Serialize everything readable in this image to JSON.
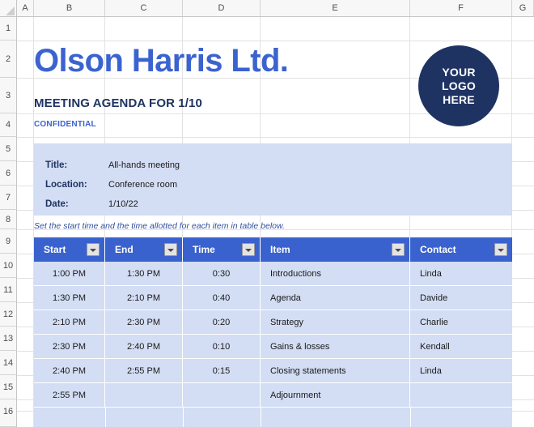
{
  "spreadsheet": {
    "column_headers": [
      "A",
      "B",
      "C",
      "D",
      "E",
      "F",
      "G"
    ],
    "row_headers": [
      "1",
      "2",
      "3",
      "4",
      "5",
      "6",
      "7",
      "8",
      "9",
      "10",
      "11",
      "12",
      "13",
      "14",
      "15",
      "16"
    ],
    "corner_icon": "select-all-triangle-icon"
  },
  "document": {
    "company_title": "Olson Harris Ltd.",
    "agenda_subtitle": "MEETING AGENDA FOR 1/10",
    "confidential_label": "CONFIDENTIAL",
    "instruction_note": "Set the start time and the time allotted for each item in table below."
  },
  "logo": {
    "line1": "YOUR",
    "line2": "LOGO",
    "line3": "HERE"
  },
  "info": {
    "rows": [
      {
        "label": "Title:",
        "value": "All-hands meeting"
      },
      {
        "label": "Location:",
        "value": "Conference room"
      },
      {
        "label": "Date:",
        "value": "1/10/22"
      }
    ]
  },
  "agenda_table": {
    "columns": [
      "Start",
      "End",
      "Time",
      "Item",
      "Contact"
    ],
    "filter_icon": "filter-dropdown-icon",
    "rows": [
      {
        "start": "1:00 PM",
        "end": "1:30 PM",
        "time": "0:30",
        "item": "Introductions",
        "contact": "Linda"
      },
      {
        "start": "1:30 PM",
        "end": "2:10 PM",
        "time": "0:40",
        "item": "Agenda",
        "contact": "Davide"
      },
      {
        "start": "2:10 PM",
        "end": "2:30 PM",
        "time": "0:20",
        "item": "Strategy",
        "contact": "Charlie"
      },
      {
        "start": "2:30 PM",
        "end": "2:40 PM",
        "time": "0:10",
        "item": "Gains & losses",
        "contact": "Kendall"
      },
      {
        "start": "2:40 PM",
        "end": "2:55 PM",
        "time": "0:15",
        "item": "Closing statements",
        "contact": "Linda"
      },
      {
        "start": "2:55 PM",
        "end": "",
        "time": "",
        "item": "Adjournment",
        "contact": ""
      }
    ]
  },
  "colors": {
    "header_blue": "#3A62CE",
    "row_fill": "#D3DDF4",
    "title_blue": "#3B63D0",
    "navy": "#1F3363"
  }
}
